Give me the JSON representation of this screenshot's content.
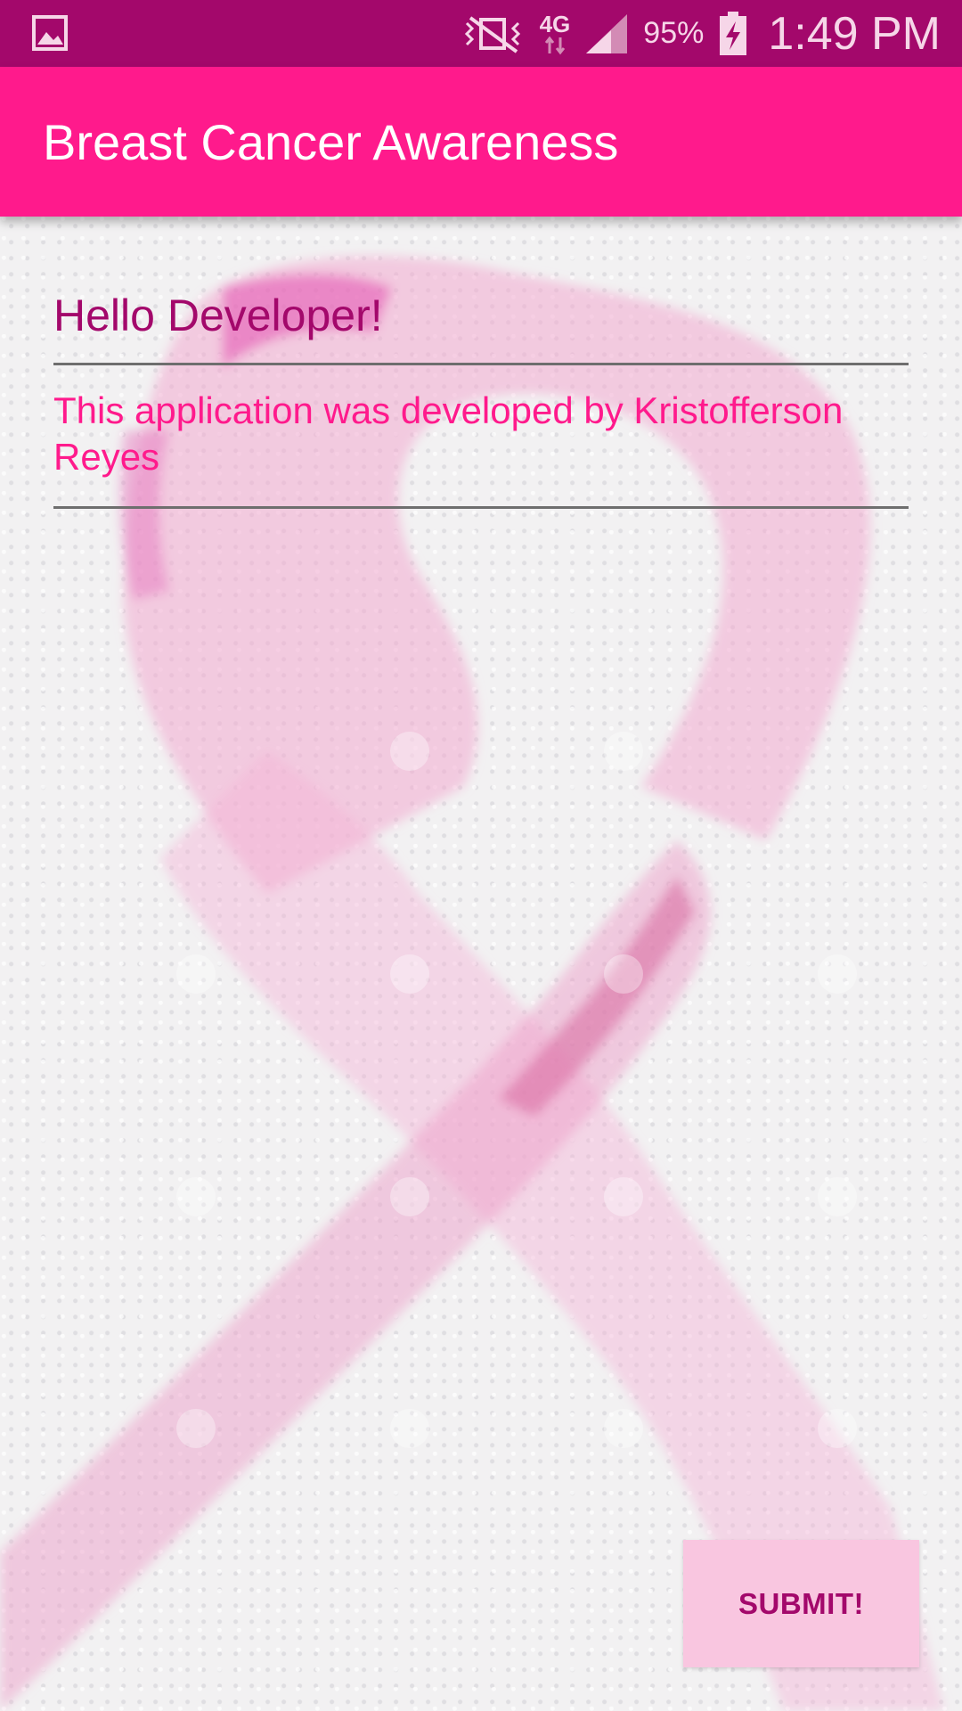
{
  "status_bar": {
    "notification_icon": "image-icon",
    "vibrate_icon": "vibrate-off-icon",
    "network_type": "4G",
    "signal_icon": "signal-icon",
    "battery_percent": "95%",
    "battery_icon": "battery-charging-icon",
    "time": "1:49 PM"
  },
  "app_bar": {
    "title": "Breast Cancer Awareness"
  },
  "main": {
    "greeting": "Hello Developer!",
    "credit": "This application was developed by Kristofferson Reyes",
    "submit_label": "SUBMIT!"
  },
  "colors": {
    "status_bar": "#a3086b",
    "app_bar": "#ff1a8c",
    "greeting_text": "#a3086b",
    "credit_text": "#ff1a8c",
    "button_bg": "#f9c6e0",
    "button_text": "#a3086b"
  }
}
